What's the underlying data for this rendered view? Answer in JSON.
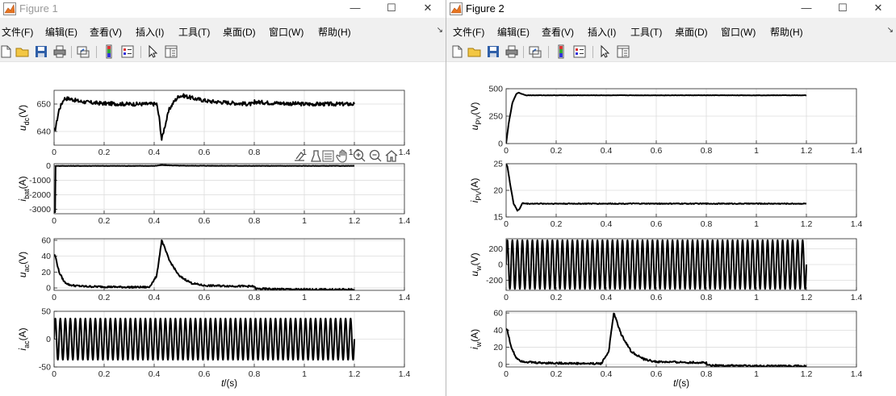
{
  "window1": {
    "title": "Figure 1",
    "controls": {
      "minimize": "—",
      "maximize": "☐",
      "close": "✕"
    },
    "menu": [
      "文件(F)",
      "编辑(E)",
      "查看(V)",
      "插入(I)",
      "工具(T)",
      "桌面(D)",
      "窗口(W)",
      "帮助(H)"
    ],
    "dock_symbol": "↘",
    "toolbar": [
      "new-file-icon",
      "open-folder-icon",
      "save-icon",
      "print-icon",
      "link-plot-icon",
      "colorbar-icon",
      "legend-icon",
      "edit-plot-arrow-icon",
      "property-inspector-icon"
    ],
    "axes_toolbar": [
      "export-icon",
      "brush-icon",
      "data-tips-icon",
      "pan-icon",
      "zoom-in-icon",
      "zoom-out-icon",
      "home-icon"
    ]
  },
  "window2": {
    "title": "Figure 2",
    "controls": {
      "minimize": "—",
      "maximize": "☐",
      "close": "✕"
    },
    "menu": [
      "文件(F)",
      "编辑(E)",
      "查看(V)",
      "插入(I)",
      "工具(T)",
      "桌面(D)",
      "窗口(W)",
      "帮助(H)"
    ],
    "dock_symbol": "↘",
    "toolbar": [
      "new-file-icon",
      "open-folder-icon",
      "save-icon",
      "print-icon",
      "link-plot-icon",
      "colorbar-icon",
      "legend-icon",
      "edit-plot-arrow-icon",
      "property-inspector-icon"
    ]
  },
  "colors": {
    "trace": "#000000",
    "grid": "#dcdcdc",
    "axis": "#262626",
    "window_bg": "#f0f0f0"
  },
  "chart_data": [
    {
      "id": "udc",
      "window": 1,
      "type": "line",
      "grid": true,
      "ylabel": {
        "sym": "u",
        "sub": "dc",
        "unit": "(V)"
      },
      "xlim": [
        0,
        1.4
      ],
      "ylim": [
        635,
        655
      ],
      "xticks": [
        "0",
        "0.2",
        "0.4",
        "0.6",
        "0.8",
        "1",
        "1.2",
        "1.4"
      ],
      "yticks": [
        "640",
        "650"
      ],
      "series": [
        {
          "x": [
            0,
            0.005,
            0.02,
            0.04,
            0.06,
            0.1,
            0.15,
            0.2,
            0.3,
            0.41,
            0.42,
            0.43,
            0.44,
            0.46,
            0.48,
            0.5,
            0.52,
            0.56,
            0.62,
            0.7,
            0.78,
            0.8,
            0.801,
            0.85,
            1.0,
            1.2
          ],
          "y": [
            640,
            641,
            648,
            652,
            652,
            651,
            650.5,
            650.2,
            650,
            650,
            645,
            637,
            641,
            648,
            651,
            653,
            653,
            652,
            651,
            650.5,
            650,
            650,
            650.8,
            650.5,
            650,
            650
          ],
          "noise": 0.7
        }
      ]
    },
    {
      "id": "ibat",
      "window": 1,
      "type": "line",
      "grid": true,
      "ylabel": {
        "sym": "i",
        "sub": "bat",
        "unit": "(A)"
      },
      "xlim": [
        0,
        1.4
      ],
      "ylim": [
        -3300,
        150
      ],
      "xticks": [
        "0",
        "0.2",
        "0.4",
        "0.6",
        "0.8",
        "1",
        "1.2",
        "1.4"
      ],
      "yticks": [
        "-3000",
        "-2000",
        "-1000",
        "0"
      ],
      "series": [
        {
          "x": [
            0,
            0.004,
            0.006,
            0.02,
            0.4,
            0.43,
            0.46,
            0.5,
            0.8,
            1.2
          ],
          "y": [
            -3200,
            -3200,
            0,
            0,
            0,
            60,
            40,
            15,
            0,
            0
          ],
          "noise": 12
        }
      ]
    },
    {
      "id": "uac",
      "window": 1,
      "type": "line",
      "grid": true,
      "ylabel": {
        "sym": "u",
        "sub": "ac",
        "unit": "(V)"
      },
      "xlim": [
        0,
        1.4
      ],
      "ylim": [
        -3,
        62
      ],
      "xticks": [
        "0",
        "0.2",
        "0.4",
        "0.6",
        "0.8",
        "1",
        "1.2",
        "1.4"
      ],
      "yticks": [
        "0",
        "20",
        "40",
        "60"
      ],
      "series": [
        {
          "x": [
            0,
            0.005,
            0.02,
            0.04,
            0.06,
            0.08,
            0.12,
            0.2,
            0.3,
            0.38,
            0.41,
            0.43,
            0.44,
            0.46,
            0.5,
            0.55,
            0.6,
            0.7,
            0.8,
            0.805,
            1.0,
            1.2
          ],
          "y": [
            42,
            40,
            20,
            8,
            4,
            3,
            2,
            1.5,
            1,
            1,
            15,
            60,
            52,
            35,
            15,
            6,
            3,
            2.5,
            2,
            -1,
            -2,
            -2
          ],
          "noise": 1.1
        }
      ]
    },
    {
      "id": "iac",
      "window": 1,
      "type": "sine",
      "grid": true,
      "ylabel": {
        "sym": "i",
        "sub": "ac",
        "unit": "(A)"
      },
      "xlim": [
        0,
        1.4
      ],
      "ylim": [
        -50,
        50
      ],
      "xticks": [
        "0",
        "0.2",
        "0.4",
        "0.6",
        "0.8",
        "1",
        "1.2",
        "1.4"
      ],
      "yticks": [
        "-50",
        "0",
        "50"
      ],
      "xlabel": {
        "sym": "t",
        "unit": "/(s)"
      },
      "series": [
        {
          "amplitude": 37,
          "frequency": 50,
          "x_start": 0,
          "x_end": 1.2
        }
      ]
    },
    {
      "id": "upv",
      "window": 2,
      "type": "line",
      "grid": true,
      "ylabel": {
        "sym": "u",
        "sub": "PV",
        "unit": "(V)"
      },
      "xlim": [
        0,
        1.4
      ],
      "ylim": [
        0,
        500
      ],
      "xticks": [
        "0",
        "0.2",
        "0.4",
        "0.6",
        "0.8",
        "1",
        "1.2",
        "1.4"
      ],
      "yticks": [
        "0",
        "250",
        "500"
      ],
      "series": [
        {
          "x": [
            0,
            0.01,
            0.025,
            0.04,
            0.05,
            0.06,
            0.08,
            0.2,
            1.2
          ],
          "y": [
            0,
            180,
            370,
            450,
            465,
            455,
            440,
            440,
            440
          ],
          "noise": 1.5
        }
      ]
    },
    {
      "id": "ipv",
      "window": 2,
      "type": "line",
      "grid": true,
      "ylabel": {
        "sym": "i",
        "sub": "PV",
        "unit": "(A)"
      },
      "xlim": [
        0,
        1.4
      ],
      "ylim": [
        15,
        25
      ],
      "xticks": [
        "0",
        "0.2",
        "0.4",
        "0.6",
        "0.8",
        "1",
        "1.2",
        "1.4"
      ],
      "yticks": [
        "15",
        "20",
        "25"
      ],
      "series": [
        {
          "x": [
            0,
            0.005,
            0.015,
            0.03,
            0.045,
            0.055,
            0.065,
            0.08,
            0.2,
            1.2
          ],
          "y": [
            25,
            24.5,
            21.5,
            17.5,
            16.2,
            16.6,
            17.6,
            17.5,
            17.5,
            17.5
          ],
          "noise": 0.08
        }
      ]
    },
    {
      "id": "uw",
      "window": 2,
      "type": "sine",
      "grid": true,
      "ylabel": {
        "sym": "u",
        "sub": "w",
        "unit": "(V)"
      },
      "xlim": [
        0,
        1.4
      ],
      "ylim": [
        -330,
        330
      ],
      "xticks": [
        "0",
        "0.2",
        "0.4",
        "0.6",
        "0.8",
        "1",
        "1.2",
        "1.4"
      ],
      "yticks": [
        "-200",
        "0",
        "200"
      ],
      "series": [
        {
          "amplitude": 311,
          "frequency": 50,
          "x_start": 0,
          "x_end": 1.2
        }
      ]
    },
    {
      "id": "iw",
      "window": 2,
      "type": "line",
      "grid": true,
      "ylabel": {
        "sym": "i",
        "sub": "w",
        "unit": "(A)"
      },
      "xlim": [
        0,
        1.4
      ],
      "ylim": [
        -3,
        62
      ],
      "xticks": [
        "0",
        "0.2",
        "0.4",
        "0.6",
        "0.8",
        "1",
        "1.2",
        "1.4"
      ],
      "yticks": [
        "0",
        "20",
        "40",
        "60"
      ],
      "xlabel": {
        "sym": "t",
        "unit": "/(s)"
      },
      "series": [
        {
          "x": [
            0,
            0.005,
            0.02,
            0.04,
            0.06,
            0.08,
            0.12,
            0.2,
            0.3,
            0.38,
            0.41,
            0.43,
            0.44,
            0.46,
            0.5,
            0.55,
            0.6,
            0.7,
            0.8,
            0.805,
            1.0,
            1.2
          ],
          "y": [
            42,
            40,
            20,
            8,
            4,
            3,
            2,
            1.5,
            1,
            1,
            15,
            60,
            52,
            35,
            15,
            6,
            3,
            2.5,
            2,
            -1,
            -2,
            -2
          ],
          "noise": 1.1
        }
      ]
    }
  ]
}
